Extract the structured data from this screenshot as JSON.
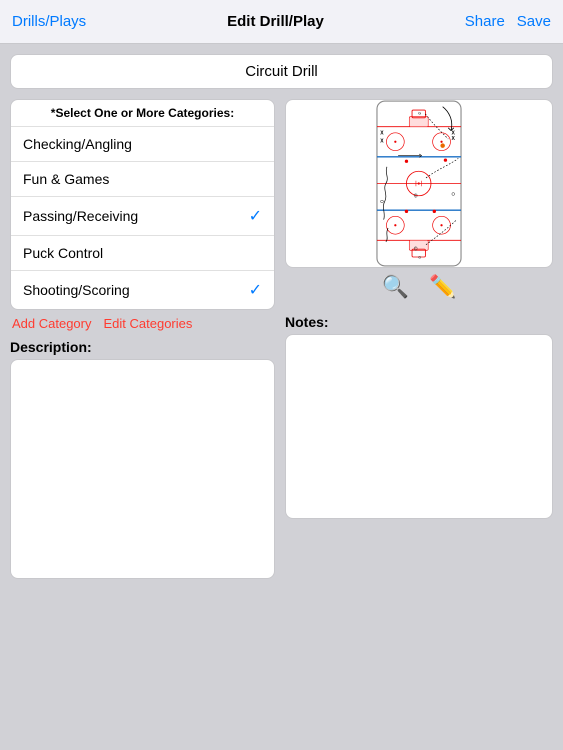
{
  "header": {
    "back_label": "Drills/Plays",
    "title": "Edit Drill/Play",
    "share_label": "Share",
    "save_label": "Save"
  },
  "drill": {
    "title": "Circuit Drill"
  },
  "categories": {
    "header": "*Select One or More Categories:",
    "items": [
      {
        "name": "Checking/Angling",
        "selected": false
      },
      {
        "name": "Fun & Games",
        "selected": false
      },
      {
        "name": "Passing/Receiving",
        "selected": true
      },
      {
        "name": "Puck Control",
        "selected": false
      },
      {
        "name": "Shooting/Scoring",
        "selected": true
      }
    ],
    "add_label": "Add Category",
    "edit_label": "Edit Categories"
  },
  "description": {
    "label": "Description:"
  },
  "notes": {
    "label": "Notes:"
  },
  "icons": {
    "zoom": "🔍",
    "pencil": "✏️"
  }
}
